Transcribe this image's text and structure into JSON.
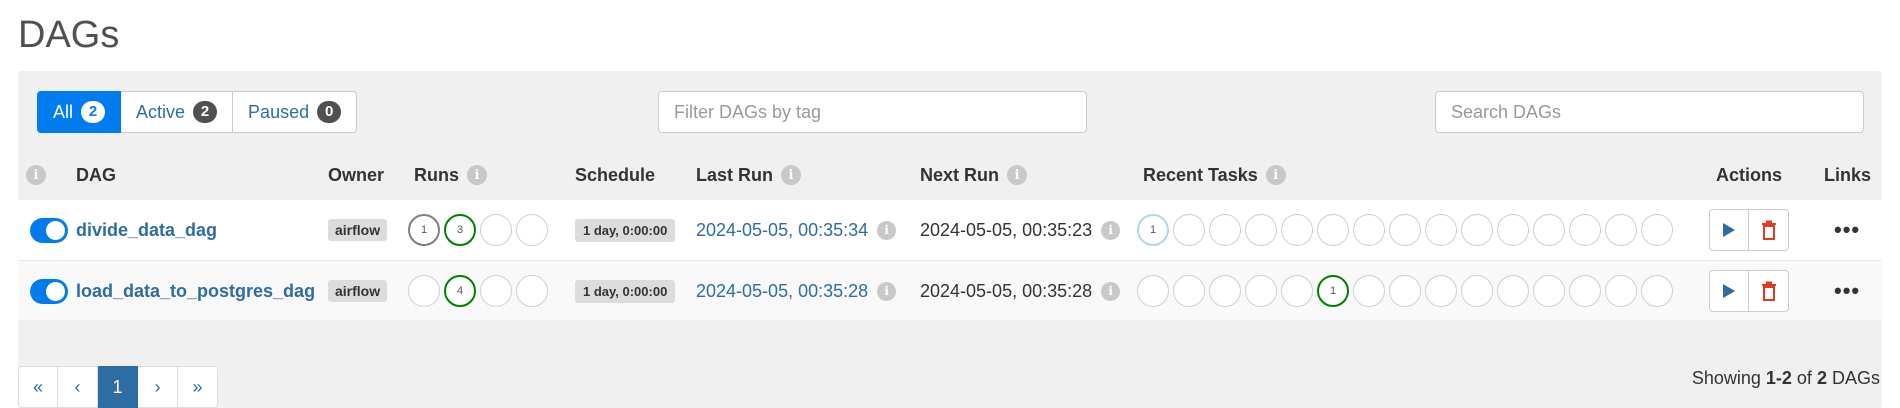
{
  "page_title": "DAGs",
  "status_filter": {
    "all": {
      "label": "All",
      "count": "2"
    },
    "active": {
      "label": "Active",
      "count": "2"
    },
    "paused": {
      "label": "Paused",
      "count": "0"
    }
  },
  "tag_filter": {
    "placeholder": "Filter DAGs by tag"
  },
  "search": {
    "placeholder": "Search DAGs"
  },
  "columns": {
    "dag": "DAG",
    "owner": "Owner",
    "runs": "Runs",
    "schedule": "Schedule",
    "last_run": "Last Run",
    "next_run": "Next Run",
    "recent_tasks": "Recent Tasks",
    "actions": "Actions",
    "links": "Links"
  },
  "info_icon_glyph": "i",
  "rows": [
    {
      "dag_id": "divide_data_dag",
      "owner": "airflow",
      "runs": [
        "1",
        "3",
        "",
        ""
      ],
      "schedule": "1 day, 0:00:00",
      "last_run": "2024-05-05, 00:35:34",
      "next_run": "2024-05-05, 00:35:23",
      "recent_tasks": [
        "1",
        "",
        "",
        "",
        "",
        "",
        "",
        "",
        "",
        "",
        "",
        "",
        "",
        "",
        "",
        ""
      ]
    },
    {
      "dag_id": "load_data_to_postgres_dag",
      "owner": "airflow",
      "runs": [
        "",
        "4",
        "",
        ""
      ],
      "schedule": "1 day, 0:00:00",
      "last_run": "2024-05-05, 00:35:28",
      "next_run": "2024-05-05, 00:35:28",
      "recent_tasks": [
        "",
        "",
        "",
        "",
        "",
        "1",
        "",
        "",
        "",
        "",
        "",
        "",
        "",
        "",
        "",
        ""
      ]
    }
  ],
  "more_glyph": "•••",
  "pagination": {
    "first": "«",
    "prev": "‹",
    "current": "1",
    "next": "›",
    "last": "»"
  },
  "showing": {
    "prefix": "Showing",
    "range": "1-2",
    "of": "of",
    "total": "2",
    "suffix": "DAGs"
  },
  "colors": {
    "accent": "#017cee",
    "link": "#2e6da4",
    "running_queued_grey": "#808080",
    "success_green": "#008000",
    "light_blue": "#add8e6",
    "delete_red": "#e43921"
  }
}
